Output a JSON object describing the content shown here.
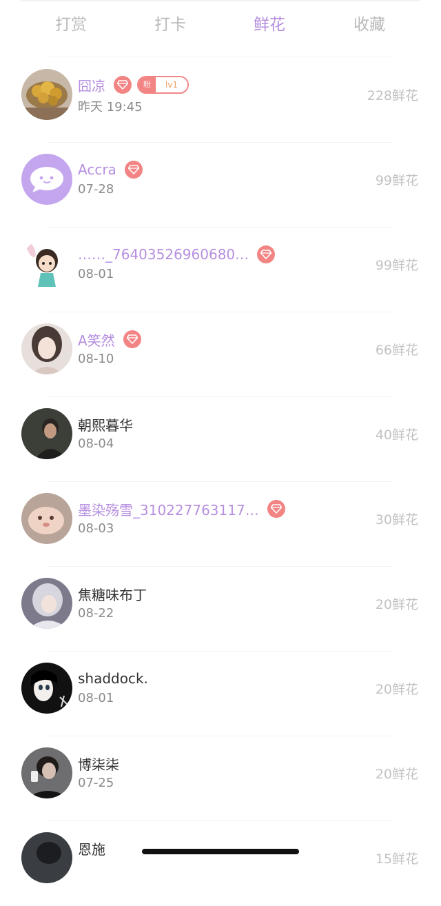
{
  "tabs": [
    {
      "label": "打赏",
      "active": false
    },
    {
      "label": "打卡",
      "active": false
    },
    {
      "label": "鲜花",
      "active": true
    },
    {
      "label": "收藏",
      "active": false
    }
  ],
  "accent_color": "#b48ddf",
  "badge_color": "#f38484",
  "list": [
    {
      "name": "囧凉",
      "time": "昨天 19:45",
      "amount": "228鲜花",
      "vip": true,
      "gem_icon": "diamond-icon",
      "fan_badge": {
        "label": "粉",
        "level": "lv1"
      }
    },
    {
      "name": "Accra",
      "time": "07-28",
      "amount": "99鲜花",
      "vip": true,
      "gem_icon": "diamond-icon"
    },
    {
      "name": "……_76403526960680…",
      "time": "08-01",
      "amount": "99鲜花",
      "vip": true,
      "gem_icon": "diamond-icon"
    },
    {
      "name": "A笑然",
      "time": "08-10",
      "amount": "66鲜花",
      "vip": true,
      "gem_icon": "diamond-icon"
    },
    {
      "name": "朝熙暮华",
      "time": "08-04",
      "amount": "40鲜花",
      "vip": false
    },
    {
      "name": "墨染殇雪_310227763117…",
      "time": "08-03",
      "amount": "30鲜花",
      "vip": true,
      "gem_icon": "diamond-icon"
    },
    {
      "name": "焦糖味布丁",
      "time": "08-22",
      "amount": "20鲜花",
      "vip": false
    },
    {
      "name": "shaddock.",
      "time": "08-01",
      "amount": "20鲜花",
      "vip": false
    },
    {
      "name": "博柒柒",
      "time": "07-25",
      "amount": "20鲜花",
      "vip": false
    },
    {
      "name": "恩施",
      "time": "",
      "amount": "15鲜花",
      "vip": false
    }
  ]
}
